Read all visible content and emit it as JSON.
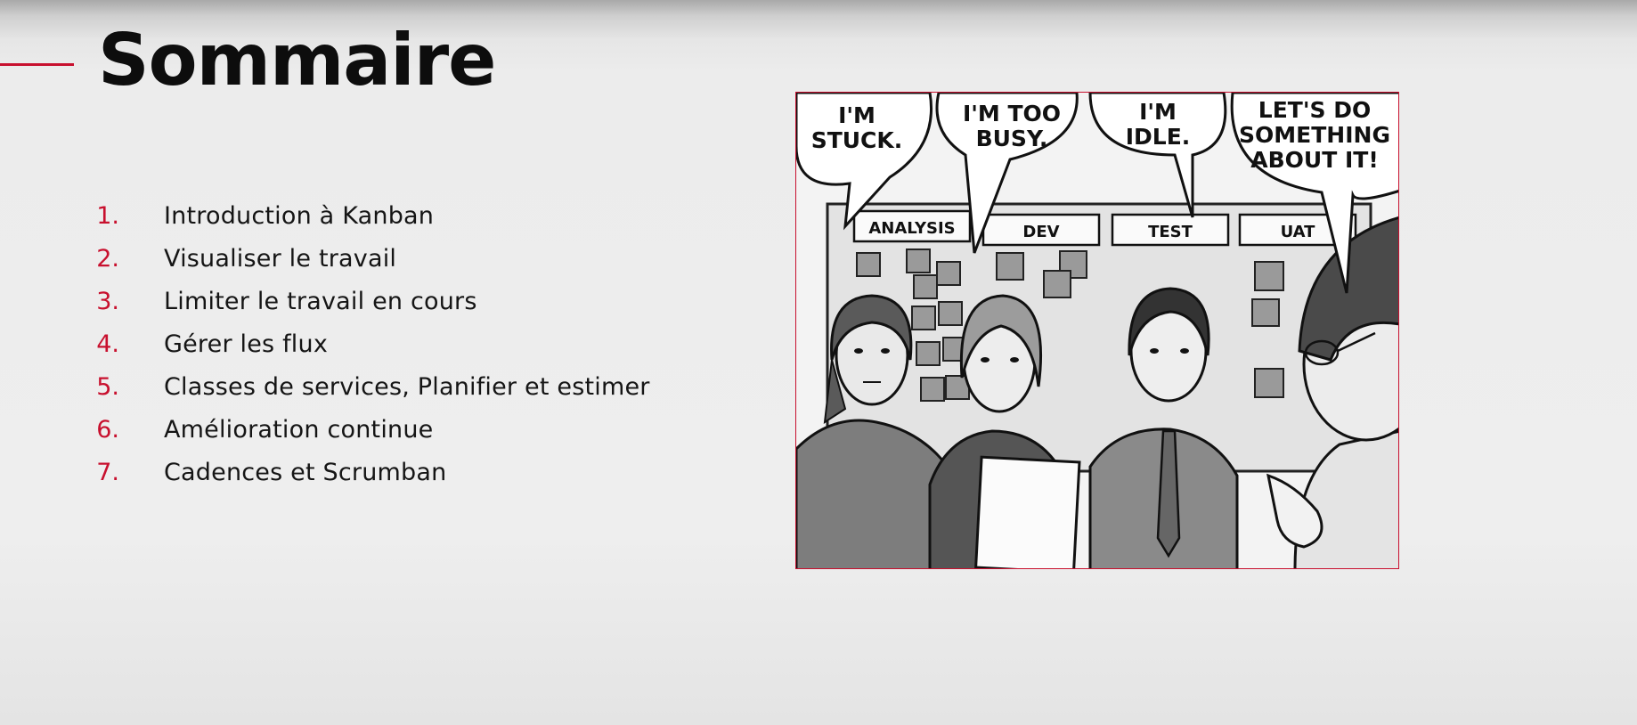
{
  "slide": {
    "title": "Sommaire",
    "agenda": [
      {
        "num": "1.",
        "label": "Introduction à Kanban"
      },
      {
        "num": "2.",
        "label": "Visualiser le travail"
      },
      {
        "num": "3.",
        "label": "Limiter le travail en cours"
      },
      {
        "num": "4.",
        "label": "Gérer les flux"
      },
      {
        "num": "5.",
        "label": "Classes de services, Planifier et estimer"
      },
      {
        "num": "6.",
        "label": "Amélioration continue"
      },
      {
        "num": "7.",
        "label": "Cadences et Scrumban"
      }
    ]
  },
  "comic": {
    "bubbles": {
      "stuck": [
        "I'M",
        "STUCK."
      ],
      "busy": [
        "I'M TOO",
        "BUSY."
      ],
      "idle": [
        "I'M",
        "IDLE."
      ],
      "act": [
        "LET'S DO",
        "SOMETHING",
        "ABOUT IT!"
      ]
    },
    "columns": [
      "ANALYSIS",
      "DEV",
      "TEST",
      "UAT"
    ]
  },
  "colors": {
    "accent": "#c8102e",
    "text": "#111111",
    "background": "#eeeeee"
  }
}
